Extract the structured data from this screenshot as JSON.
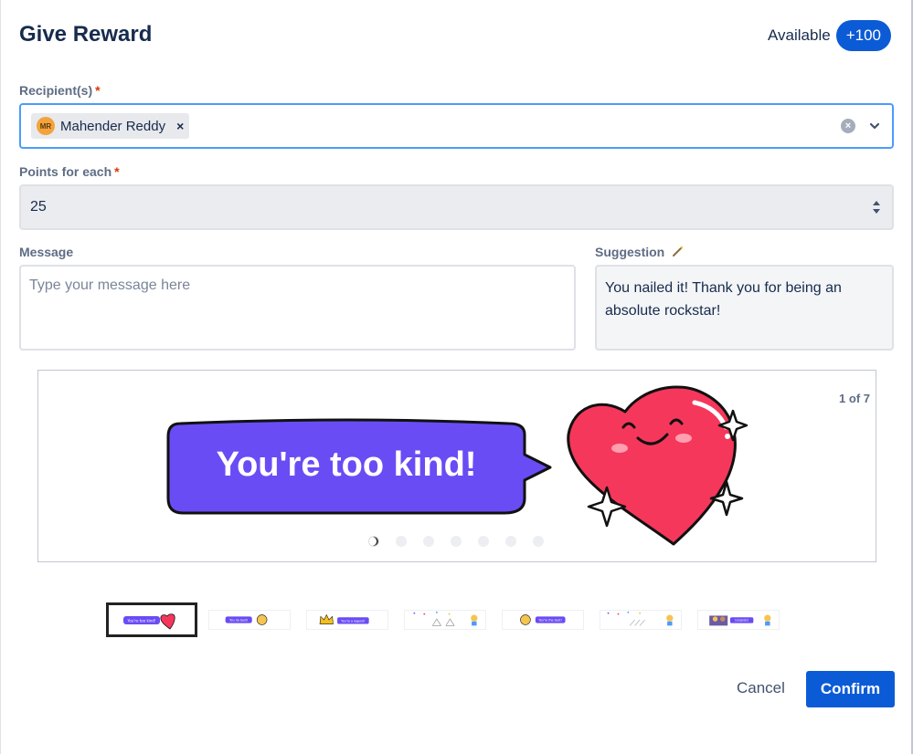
{
  "header": {
    "title": "Give Reward",
    "available_label": "Available",
    "available_value": "+100"
  },
  "recipients": {
    "label": "Recipient(s)",
    "required_mark": "*",
    "chips": [
      {
        "initials": "MR",
        "name": "Mahender Reddy",
        "remove": "×"
      }
    ],
    "clear_icon": "clear-icon",
    "dropdown_icon": "chevron-down-icon"
  },
  "points": {
    "label": "Points for each",
    "required_mark": "*",
    "value": "25"
  },
  "message": {
    "label": "Message",
    "placeholder": "Type your message here",
    "value": ""
  },
  "suggestion": {
    "label": "Suggestion",
    "icon": "magic-wand-icon",
    "text": "You nailed it! Thank you for being an absolute rockstar!"
  },
  "carousel": {
    "counter": "1 of 7",
    "current_image_text": "You're too kind!",
    "total": 7,
    "active_index": 0
  },
  "thumbnails": [
    {
      "text": "You're too kind!",
      "active": true
    },
    {
      "text": "You do best!",
      "active": false
    },
    {
      "text": "You're a legend!",
      "active": false
    },
    {
      "text": "",
      "active": false
    },
    {
      "text": "You're the best!",
      "active": false
    },
    {
      "text": "",
      "active": false
    },
    {
      "text": "Congrats!",
      "active": false
    }
  ],
  "footer": {
    "cancel_label": "Cancel",
    "confirm_label": "Confirm"
  },
  "colors": {
    "primary": "#0c5bd6",
    "focus_border": "#4c9aff",
    "required": "#de350b",
    "bubble": "#6a4cf5",
    "heart": "#f5375b"
  }
}
